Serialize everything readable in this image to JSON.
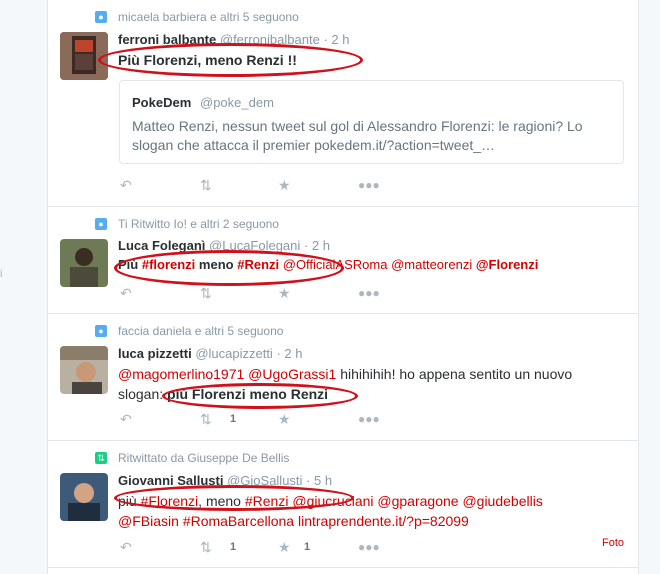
{
  "side_letter": "i",
  "tweets": [
    {
      "context": "micaela barbiera e altri 5 seguono",
      "name": "ferroni balbante",
      "handle": "@ferronibalbante",
      "time": "· 2 h",
      "text": "Più Florenzi, meno Renzi !!",
      "quote": {
        "name": "PokeDem",
        "handle": "@poke_dem",
        "text": "Matteo Renzi, nessun tweet sul gol di Alessandro Florenzi: le ragioni? Lo slogan che attacca il premier pokedem.it/?action=tweet_…"
      }
    },
    {
      "context": "Ti Ritwitto Io! e altri 2 seguono",
      "name": "Luca Foleganì",
      "handle": "@LucaFolegani",
      "time": "· 2 h",
      "text_parts": [
        "Più ",
        "#florenzi",
        " meno ",
        "#Renzi",
        " ",
        "@OfficialASRoma",
        " ",
        "@matteorenzi",
        "  ",
        "@Florenzi"
      ]
    },
    {
      "context": "faccia daniela e altri 5 seguono",
      "name": "luca pizzetti",
      "handle": "@lucapizzetti",
      "time": "· 2 h",
      "text_parts": [
        "@magomerlino1971",
        " ",
        "@UgoGrassi1",
        " hihihihih! ho appena sentito un nuovo slogan: ",
        "più Florenzi meno Renzi"
      ],
      "retweets": "1"
    },
    {
      "context": "Ritwittato da Giuseppe De Bellis",
      "name": "Giovanni Sallusti",
      "handle": "@GioSallusti",
      "time": "· 5 h",
      "text_parts": [
        "più ",
        "#Florenzi",
        ", meno ",
        "#Renzi",
        " ",
        "@giucruciani",
        " ",
        "@gparagone",
        " ",
        "@giudebellis",
        " ",
        "@FBiasin",
        " ",
        "#RomaBarcellona",
        " ",
        "lintraprendente.it/?p=82099"
      ],
      "retweets": "1",
      "favorites": "1",
      "foto": "Foto"
    }
  ],
  "icons": {
    "reply": "reply-icon",
    "retweet": "retweet-icon",
    "favorite": "star-icon",
    "more": "more-icon",
    "follow": "follow-icon",
    "retweeted": "retweeted-icon"
  },
  "colors": {
    "link": "#d40000",
    "annotation": "#d0101b",
    "follow_badge": "#55acee",
    "retweet_badge": "#19cf86"
  }
}
